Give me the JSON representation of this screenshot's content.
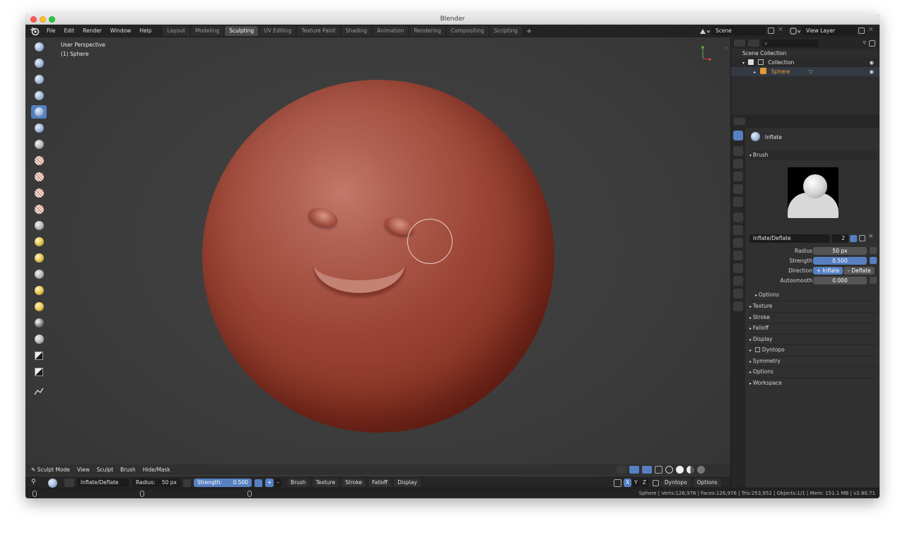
{
  "window": {
    "title": "Blender"
  },
  "menu": {
    "items": [
      "File",
      "Edit",
      "Render",
      "Window",
      "Help"
    ]
  },
  "workspaces": {
    "tabs": [
      "Layout",
      "Modeling",
      "Sculpting",
      "UV Editing",
      "Texture Paint",
      "Shading",
      "Animation",
      "Rendering",
      "Compositing",
      "Scripting"
    ],
    "active": "Sculpting",
    "add_label": "+"
  },
  "scene": {
    "name": "Scene",
    "view_layer": "View Layer"
  },
  "viewport": {
    "perspective": "User Perspective",
    "object": "(1) Sphere",
    "header": {
      "mode": "Sculpt Mode",
      "menus": [
        "View",
        "Sculpt",
        "Brush",
        "Hide/Mask"
      ]
    }
  },
  "tool_header": {
    "brush_name": "Inflate/Deflate",
    "radius_label": "Radius:",
    "radius_value": "50 px",
    "strength_label": "Strength:",
    "strength_value": "0.500",
    "plus": "+",
    "minus": "–",
    "menus": [
      "Brush",
      "Texture",
      "Stroke",
      "Falloff",
      "Display"
    ],
    "axes": [
      "X",
      "Y",
      "Z"
    ],
    "dyntopo": "Dyntopo",
    "options": "Options"
  },
  "status": {
    "text": "Sphere | Verts:126,978 | Faces:126,976 | Tris:253,952 | Objects:1/1 | Mem: 151.1 MB | v2.80.71"
  },
  "outliner": {
    "root": "Scene Collection",
    "collection": "Collection",
    "object": "Sphere"
  },
  "properties": {
    "tool_name": "Inflate",
    "brush_panel": "Brush",
    "brush_datablock": "Inflate/Deflate",
    "users": "2",
    "radius_label": "Radius",
    "radius_value": "50 px",
    "strength_label": "Strength",
    "strength_value": "0.500",
    "direction_label": "Direction",
    "direction_inflate": "+  Inflate",
    "direction_deflate": "–  Deflate",
    "autosmooth_label": "Autosmooth",
    "autosmooth_value": "0.000",
    "options_sub": "Options",
    "panels": [
      "Texture",
      "Stroke",
      "Falloff",
      "Display",
      "Dyntopo",
      "Symmetry",
      "Options",
      "Workspace"
    ]
  },
  "colors": {
    "accent": "#5680c2",
    "object_selected": "#e89b2f",
    "sphere": "#9b4434"
  }
}
